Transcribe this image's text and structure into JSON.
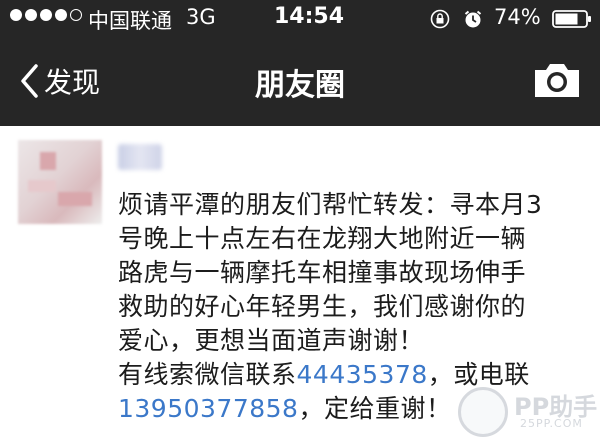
{
  "status_bar": {
    "signal_dots_filled": 4,
    "signal_dots_total": 5,
    "carrier": "中国联通",
    "network": "3G",
    "time": "14:54",
    "battery_percent": "74%",
    "icons": [
      "signal-dots-icon",
      "rotation-lock-icon",
      "alarm-icon",
      "battery-icon"
    ]
  },
  "nav": {
    "back_label": "发现",
    "title": "朋友圈",
    "icons": [
      "chevron-left-icon",
      "camera-icon"
    ]
  },
  "post": {
    "lines": [
      {
        "text": "烦请平潭的朋友们帮忙转发：寻本月3"
      },
      {
        "text": "号晚上十点左右在龙翔大地附近一辆"
      },
      {
        "text": "路虎与一辆摩托车相撞事故现场伸手"
      },
      {
        "text": "救助的好心年轻男生，我们感谢你的"
      },
      {
        "text": "爱心，更想当面道声谢谢！"
      }
    ],
    "line6_prefix": "有线索微信联系",
    "wechat_id": "44435378",
    "line6_suffix": "，或电联",
    "phone": "13950377858",
    "line7_suffix": "，定给重谢！"
  },
  "watermark": {
    "logo": "PP助手",
    "sub": "25PP.COM"
  },
  "colors": {
    "header_bg": "#262626",
    "link": "#3b78c9",
    "text": "#1c1c1c"
  }
}
